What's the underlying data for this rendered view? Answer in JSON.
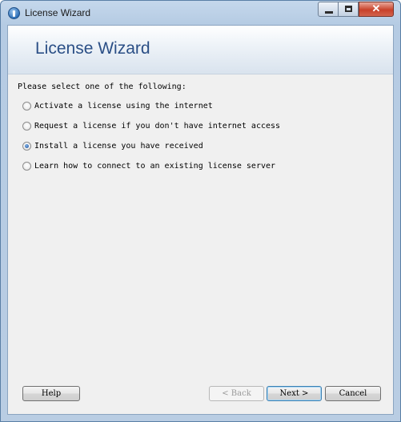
{
  "window": {
    "title": "License Wizard",
    "minimize_glyph": "",
    "maximize_glyph": "",
    "close_glyph": "✕"
  },
  "header": {
    "title": "License Wizard"
  },
  "body": {
    "prompt": "Please select one of the following:",
    "options": [
      {
        "label": "Activate a license using the internet",
        "checked": false
      },
      {
        "label": "Request a license if you don't have internet access",
        "checked": false
      },
      {
        "label": "Install a license you have received",
        "checked": true
      },
      {
        "label": "Learn how to connect to an existing license server",
        "checked": false
      }
    ]
  },
  "footer": {
    "help_label": "Help",
    "back_label": "< Back",
    "next_label": "Next >",
    "cancel_label": "Cancel"
  }
}
